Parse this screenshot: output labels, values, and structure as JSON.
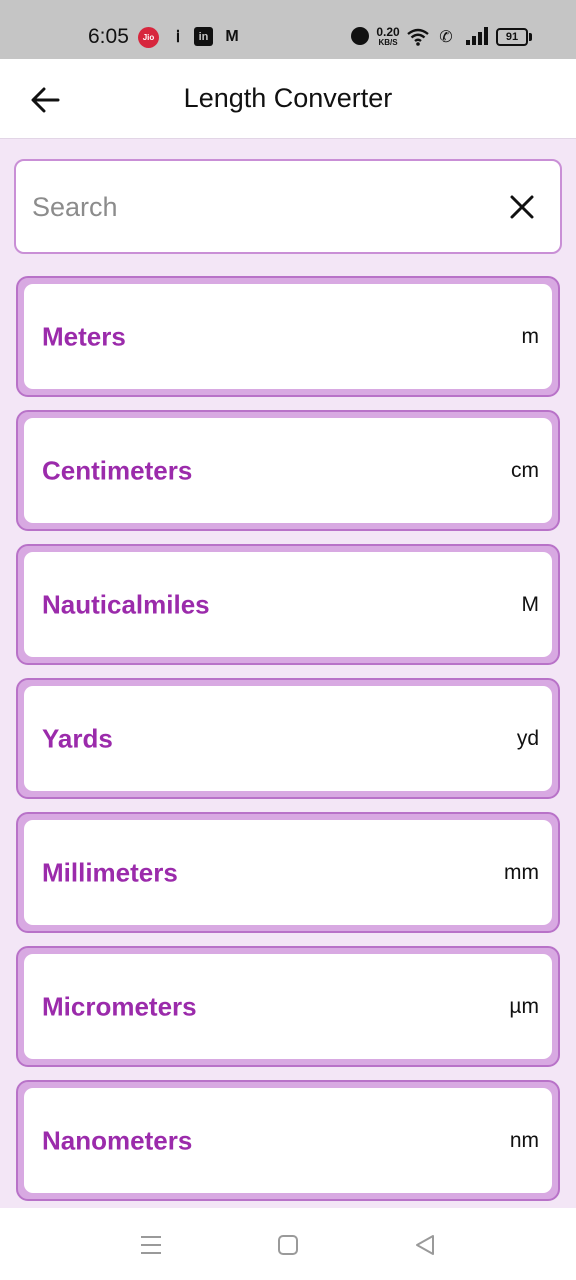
{
  "status_bar": {
    "time": "6:05",
    "carrier_icon_text": "Jio",
    "network_speed": "0.20",
    "network_speed_unit": "KB/S",
    "battery": "91"
  },
  "header": {
    "title": "Length Converter"
  },
  "search": {
    "placeholder": "Search",
    "value": ""
  },
  "units": [
    {
      "name": "Meters",
      "symbol": "m"
    },
    {
      "name": "Centimeters",
      "symbol": "cm"
    },
    {
      "name": "Nauticalmiles",
      "symbol": "M"
    },
    {
      "name": "Yards",
      "symbol": "yd"
    },
    {
      "name": "Millimeters",
      "symbol": "mm"
    },
    {
      "name": "Micrometers",
      "symbol": "µm"
    },
    {
      "name": "Nanometers",
      "symbol": "nm"
    }
  ],
  "colors": {
    "accent": "#9b2bab",
    "card_border": "#b872c8",
    "background": "#f3e6f6"
  }
}
